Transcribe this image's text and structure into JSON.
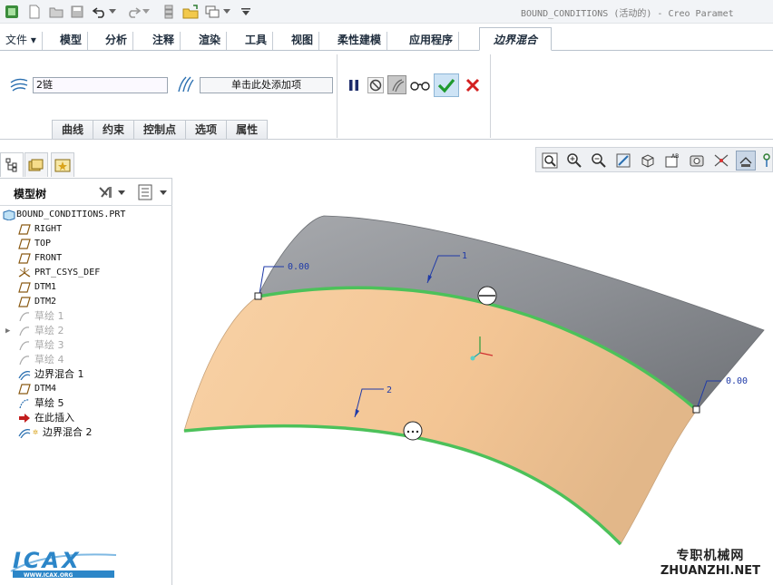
{
  "window": {
    "title": "BOUND_CONDITIONS (活动的) - Creo Paramet"
  },
  "ribbon_tabs": [
    {
      "label": "文件 ▾"
    },
    {
      "label": "模型"
    },
    {
      "label": "分析"
    },
    {
      "label": "注释"
    },
    {
      "label": "渲染"
    },
    {
      "label": "工具"
    },
    {
      "label": "视图"
    },
    {
      "label": "柔性建模"
    },
    {
      "label": "应用程序"
    },
    {
      "label": "边界混合"
    }
  ],
  "dashboard": {
    "first_direction_value": "2链",
    "second_direction_placeholder": "单击此处添加项",
    "subtabs": [
      "曲线",
      "约束",
      "控制点",
      "选项",
      "属性"
    ]
  },
  "model_tree": {
    "header": "模型树",
    "items": [
      {
        "label": "BOUND_CONDITIONS.PRT",
        "icon": "part-icon"
      },
      {
        "label": "RIGHT",
        "icon": "datum-plane-icon"
      },
      {
        "label": "TOP",
        "icon": "datum-plane-icon"
      },
      {
        "label": "FRONT",
        "icon": "datum-plane-icon"
      },
      {
        "label": "PRT_CSYS_DEF",
        "icon": "csys-icon"
      },
      {
        "label": "DTM1",
        "icon": "datum-plane-icon"
      },
      {
        "label": "DTM2",
        "icon": "datum-plane-icon"
      },
      {
        "label": "草绘 1",
        "icon": "sketch-icon"
      },
      {
        "label": "草绘 2",
        "icon": "sketch-icon"
      },
      {
        "label": "草绘 3",
        "icon": "sketch-icon"
      },
      {
        "label": "草绘 4",
        "icon": "sketch-icon"
      },
      {
        "label": "边界混合 1",
        "icon": "boundary-blend-icon"
      },
      {
        "label": "DTM4",
        "icon": "datum-plane-icon"
      },
      {
        "label": "草绘 5",
        "icon": "sketch-icon"
      },
      {
        "label": "在此插入",
        "icon": "insert-here-arrow-icon"
      },
      {
        "label": "边界混合 2",
        "icon": "boundary-blend-icon"
      }
    ]
  },
  "canvas": {
    "labels": {
      "curve1": "1",
      "curve2": "2",
      "param_left": "0.00",
      "param_right": "0.00"
    },
    "colors": {
      "surface_new": "#f4c796",
      "surface_existing": "#8e9196",
      "chain_highlight": "#4cc15a",
      "annotation": "#1f3aa8"
    }
  },
  "watermark": {
    "cn": "专职机械网",
    "en": "ZHUANZHI.NET"
  },
  "logo": {
    "text": "ICAX",
    "url_text": "WWW.ICAX.ORG"
  }
}
